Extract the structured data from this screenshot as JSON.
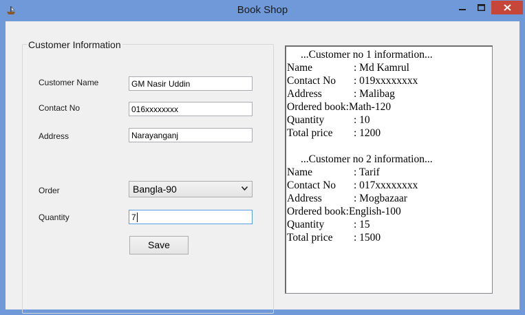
{
  "window": {
    "title": "Book Shop"
  },
  "form": {
    "group_title": "Customer Information",
    "customer_name_label": "Customer Name",
    "customer_name_value": "GM Nasir Uddin",
    "contact_label": "Contact No",
    "contact_value": "016xxxxxxxx",
    "address_label": "Address",
    "address_value": "Narayanganj",
    "order_label": "Order",
    "order_value": "Bangla-90",
    "quantity_label": "Quantity",
    "quantity_value": "7",
    "save_label": "Save"
  },
  "info": {
    "customers": [
      {
        "header": "...Customer no 1 information...",
        "name_key": "Name",
        "name_val": ": Md Kamrul",
        "contact_key": "Contact No",
        "contact_val": ": 019xxxxxxxx",
        "address_key": "Address",
        "address_val": ": Malibag",
        "book_key": "Ordered book:",
        "book_val": " Math-120",
        "qty_key": "Quantity",
        "qty_val": ": 10",
        "price_key": "Total price",
        "price_val": ": 1200"
      },
      {
        "header": "...Customer no 2 information...",
        "name_key": "Name",
        "name_val": ": Tarif",
        "contact_key": "Contact No",
        "contact_val": ": 017xxxxxxxx",
        "address_key": "Address",
        "address_val": ": Mogbazaar",
        "book_key": "Ordered book:",
        "book_val": " English-100",
        "qty_key": "Quantity",
        "qty_val": ": 15",
        "price_key": "Total price",
        "price_val": ": 1500"
      }
    ]
  },
  "icons": {
    "app": "ship-icon",
    "minimize": "minimize-icon",
    "maximize": "maximize-icon",
    "close": "close-icon",
    "dropdown": "chevron-down-icon"
  },
  "colors": {
    "frame": "#6f99d8",
    "close_button": "#c7463a",
    "client": "#f0f0f0"
  }
}
